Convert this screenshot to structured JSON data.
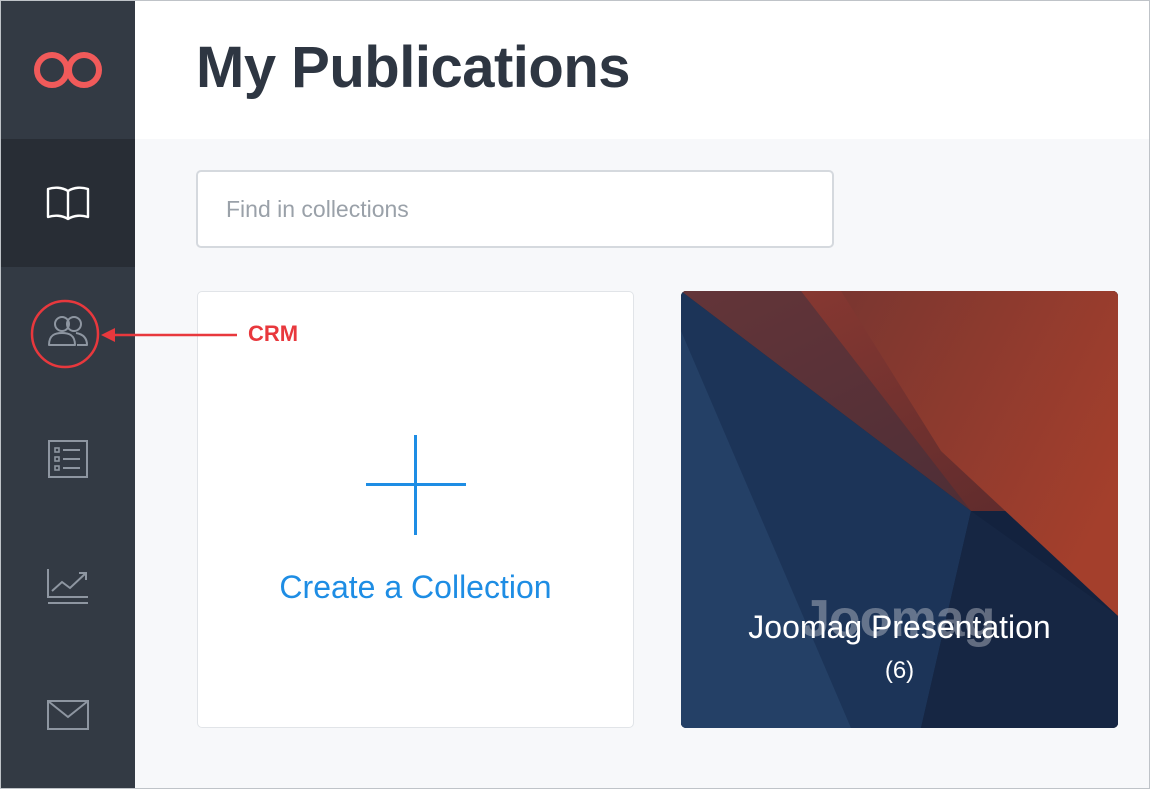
{
  "header": {
    "title": "My Publications"
  },
  "search": {
    "placeholder": "Find in collections",
    "value": ""
  },
  "sidebar": {
    "items": [
      {
        "name": "logo",
        "icon": "infinity-logo-icon"
      },
      {
        "name": "publications",
        "icon": "open-book-icon",
        "active": true
      },
      {
        "name": "crm",
        "icon": "users-icon"
      },
      {
        "name": "list",
        "icon": "checklist-icon"
      },
      {
        "name": "analytics",
        "icon": "line-chart-icon"
      },
      {
        "name": "mail",
        "icon": "envelope-icon"
      }
    ]
  },
  "create_card": {
    "label": "Create a Collection",
    "icon": "plus-icon"
  },
  "collections": [
    {
      "title": "Joomag Presentation",
      "count": "(6)",
      "cover_wordmark": "Joomag"
    }
  ],
  "annotation": {
    "label": "CRM",
    "color": "#e8383d"
  },
  "colors": {
    "sidebar": "#333a44",
    "sidebar_active": "#282d35",
    "accent": "#1e8de4",
    "brand": "#f15a5a",
    "title": "#2e3642"
  }
}
